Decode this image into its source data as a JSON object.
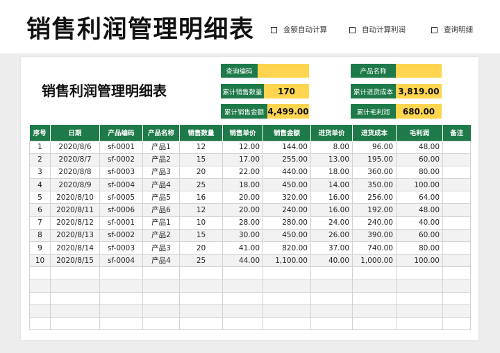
{
  "header": {
    "title": "销售利润管理明细表",
    "features": [
      {
        "label": "金额自动计算",
        "icon": "checkbox-icon"
      },
      {
        "label": "自动计算利润",
        "icon": "checkbox-icon"
      },
      {
        "label": "查询明细",
        "icon": "checkbox-icon"
      }
    ]
  },
  "sheet": {
    "title": "销售利润管理明细表",
    "query": {
      "code_label": "查询编码",
      "code_value": "",
      "name_label": "产品名称",
      "name_value": ""
    },
    "summary": {
      "qty_label": "累计销售数量",
      "qty_value": "170",
      "amount_label": "累计销售金额",
      "amount_value": "4,499.00",
      "cost_label": "累计进货成本",
      "cost_value": "3,819.00",
      "profit_label": "累计毛利润",
      "profit_value": "680.00"
    },
    "columns": [
      "序号",
      "日期",
      "产品编码",
      "产品名称",
      "销售数量",
      "销售单价",
      "销售金额",
      "进货单价",
      "进货成本",
      "毛利润",
      "备注"
    ],
    "rows": [
      [
        "1",
        "2020/8/6",
        "sf-0001",
        "产品1",
        "12",
        "12.00",
        "144.00",
        "8.00",
        "96.00",
        "48.00",
        ""
      ],
      [
        "2",
        "2020/8/7",
        "sf-0002",
        "产品2",
        "15",
        "17.00",
        "255.00",
        "13.00",
        "195.00",
        "60.00",
        ""
      ],
      [
        "3",
        "2020/8/8",
        "sf-0003",
        "产品3",
        "20",
        "22.00",
        "440.00",
        "18.00",
        "360.00",
        "80.00",
        ""
      ],
      [
        "4",
        "2020/8/9",
        "sf-0004",
        "产品4",
        "25",
        "18.00",
        "450.00",
        "14.00",
        "350.00",
        "100.00",
        ""
      ],
      [
        "5",
        "2020/8/10",
        "sf-0005",
        "产品5",
        "16",
        "20.00",
        "320.00",
        "16.00",
        "256.00",
        "64.00",
        ""
      ],
      [
        "6",
        "2020/8/11",
        "sf-0006",
        "产品6",
        "12",
        "20.00",
        "240.00",
        "16.00",
        "192.00",
        "48.00",
        ""
      ],
      [
        "7",
        "2020/8/12",
        "sf-0001",
        "产品1",
        "10",
        "28.00",
        "280.00",
        "24.00",
        "240.00",
        "40.00",
        ""
      ],
      [
        "8",
        "2020/8/13",
        "sf-0002",
        "产品2",
        "15",
        "30.00",
        "450.00",
        "26.00",
        "390.00",
        "60.00",
        ""
      ],
      [
        "9",
        "2020/8/14",
        "sf-0003",
        "产品3",
        "20",
        "41.00",
        "820.00",
        "37.00",
        "740.00",
        "80.00",
        ""
      ],
      [
        "10",
        "2020/8/15",
        "sf-0004",
        "产品4",
        "25",
        "44.00",
        "1,100.00",
        "40.00",
        "1,000.00",
        "100.00",
        ""
      ]
    ]
  },
  "colors": {
    "accent_green": "#1f7a4a",
    "highlight_yellow": "#ffd54f",
    "row_band": "#f2f2f2"
  }
}
